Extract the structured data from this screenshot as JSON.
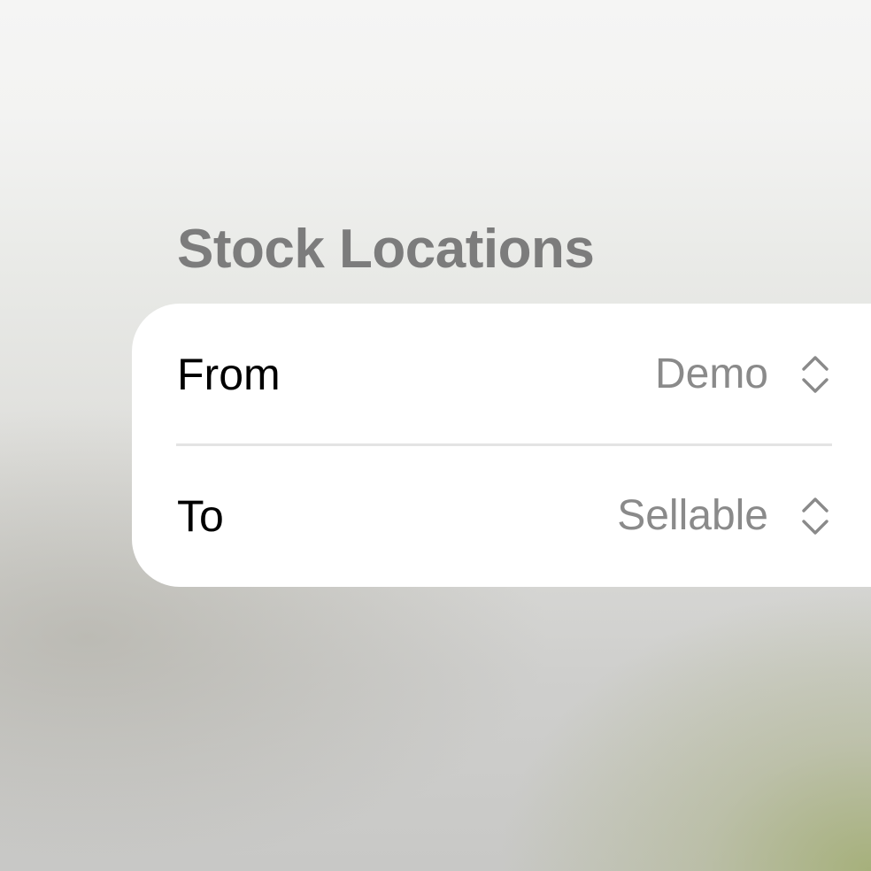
{
  "section": {
    "title": "Stock Locations"
  },
  "rows": [
    {
      "label": "From",
      "value": "Demo",
      "icon": "chevron-up-down-icon"
    },
    {
      "label": "To",
      "value": "Sellable",
      "icon": "chevron-up-down-icon"
    }
  ],
  "colors": {
    "title": "#7c7c7c",
    "label": "#000000",
    "value": "#8a8a8a",
    "icon": "#8a8a8a",
    "card": "#ffffff",
    "divider": "#e4e4e4"
  }
}
